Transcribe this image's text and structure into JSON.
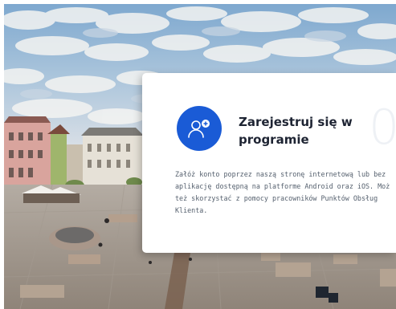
{
  "card": {
    "icon": "user-add-icon",
    "accent_color": "#1a5bd6",
    "title": "Zarejestruj się w programie",
    "step_number": "0",
    "description_lines": [
      "Załóż konto poprzez naszą stronę internetową lub bez",
      "aplikację dostępną na platforme Android oraz iOS. Moż",
      "też skorzystać z pomocy pracowników Punktów Obsług",
      "Klienta."
    ]
  },
  "hero": {
    "image": "town-square-aerial-photo"
  }
}
